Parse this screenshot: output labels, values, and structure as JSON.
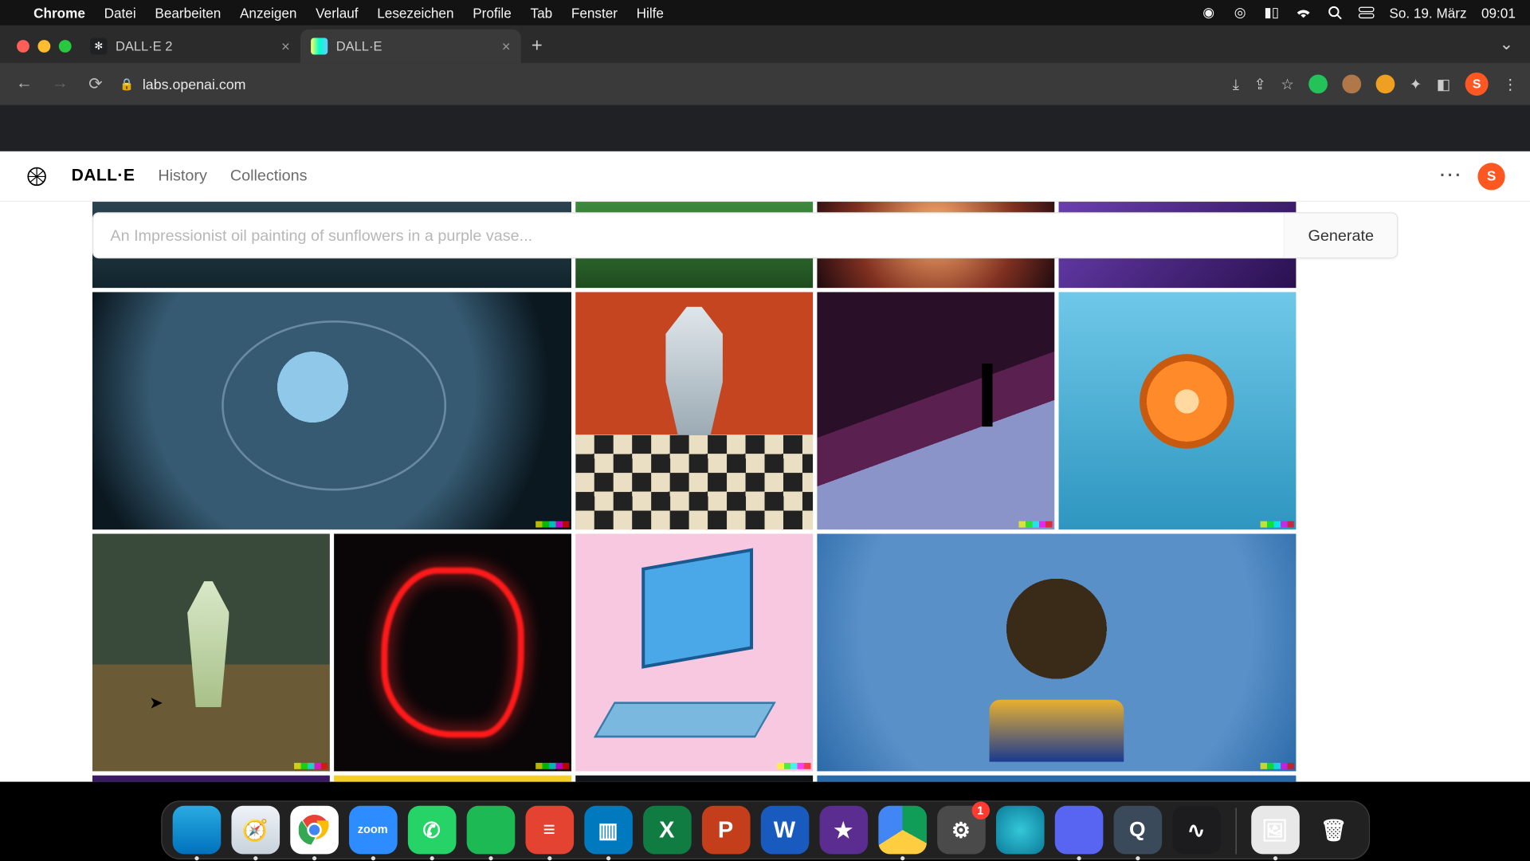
{
  "menubar": {
    "app": "Chrome",
    "items": [
      "Datei",
      "Bearbeiten",
      "Anzeigen",
      "Verlauf",
      "Lesezeichen",
      "Profile",
      "Tab",
      "Fenster",
      "Hilfe"
    ],
    "date": "So. 19. März",
    "time": "09:01"
  },
  "browser": {
    "tabs": [
      {
        "title": "DALL·E 2",
        "active": false
      },
      {
        "title": "DALL·E",
        "active": true
      }
    ],
    "url": "labs.openai.com",
    "avatar_initial": "S"
  },
  "page": {
    "brand": "DALL·E",
    "nav": {
      "history": "History",
      "collections": "Collections"
    },
    "avatar_initial": "S",
    "prompt_placeholder": "An Impressionist oil painting of sunflowers in a purple vase...",
    "generate_label": "Generate"
  },
  "gallery": {
    "row1": [
      {
        "name": "fish-in-glass-bowl"
      },
      {
        "name": "robot-playing-chess-painting"
      },
      {
        "name": "silhouette-in-purple-dunes"
      },
      {
        "name": "orange-half-on-blue"
      }
    ],
    "row2": [
      {
        "name": "astronaut-green-suit-desert"
      },
      {
        "name": "red-neon-face-profile"
      },
      {
        "name": "retro-computer-pink-cartoon"
      },
      {
        "name": "football-player-blue-painting"
      }
    ]
  },
  "dock": {
    "apps": [
      {
        "name": "finder",
        "bg": "linear-gradient(180deg,#29abe2,#0071bc)",
        "label": "",
        "running": true
      },
      {
        "name": "safari",
        "bg": "linear-gradient(180deg,#eef3f7,#c8d2dc)",
        "label": "🧭",
        "running": true
      },
      {
        "name": "chrome",
        "bg": "#fff",
        "label": "",
        "running": true,
        "chrome": true
      },
      {
        "name": "zoom",
        "bg": "#2d8cff",
        "label": "zoom",
        "running": true,
        "small": true
      },
      {
        "name": "whatsapp",
        "bg": "#25d366",
        "label": "✆",
        "running": true
      },
      {
        "name": "spotify",
        "bg": "#1db954",
        "label": "",
        "running": true
      },
      {
        "name": "todoist",
        "bg": "#e44332",
        "label": "≡",
        "running": true
      },
      {
        "name": "trello",
        "bg": "#0079bf",
        "label": "▥",
        "running": true
      },
      {
        "name": "excel",
        "bg": "#107c41",
        "label": "X",
        "running": false,
        "office": true
      },
      {
        "name": "powerpoint",
        "bg": "#c43e1c",
        "label": "P",
        "running": false,
        "office": true
      },
      {
        "name": "word",
        "bg": "#185abd",
        "label": "W",
        "running": false,
        "office": true
      },
      {
        "name": "imovie",
        "bg": "#5b2d90",
        "label": "★",
        "running": false
      },
      {
        "name": "drive",
        "bg": "conic-gradient(#0f9d58 0 33%,#ffcd40 0 66%,#4285f4 0)",
        "label": "",
        "running": true
      },
      {
        "name": "settings",
        "bg": "#4a4a4a",
        "label": "⚙",
        "running": false,
        "badge": "1"
      },
      {
        "name": "siri",
        "bg": "radial-gradient(circle,#34c8d8,#0a7a9a)",
        "label": "",
        "running": false
      },
      {
        "name": "discord",
        "bg": "#5865f2",
        "label": "",
        "running": true
      },
      {
        "name": "quicktime",
        "bg": "#3a4a5a",
        "label": "Q",
        "running": true
      },
      {
        "name": "voice-memos",
        "bg": "#1c1c1e",
        "label": "∿",
        "running": false
      }
    ],
    "right": [
      {
        "name": "preview",
        "bg": "#e8e8e8",
        "label": "🖼",
        "running": true
      },
      {
        "name": "trash",
        "bg": "transparent",
        "label": "🗑",
        "running": false
      }
    ]
  }
}
